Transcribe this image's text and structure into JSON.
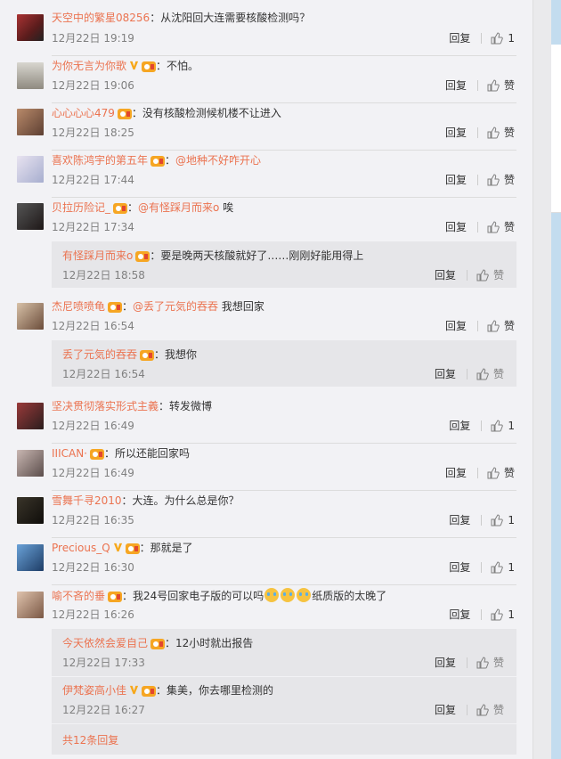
{
  "comments": [
    {
      "user": "天空中的繁星08256",
      "text": "：从沈阳回大连需要核酸检测吗？",
      "time": "12月22日 19:19",
      "reply": "回复",
      "likes": "1",
      "avatar_color": "#7a2b2b"
    },
    {
      "user": "为你无言为你歌",
      "vip": true,
      "medal": true,
      "text": "：不怕。",
      "time": "12月22日 19:06",
      "reply": "回复",
      "likes": "赞",
      "avatar_color": "#b9b6ae"
    },
    {
      "user": "心心心心479",
      "medal": true,
      "text": "：没有核酸检测候机楼不让进入",
      "time": "12月22日 18:25",
      "reply": "回复",
      "likes": "赞",
      "avatar_color": "#8a6a55"
    },
    {
      "user": "喜欢陈鸿宇的第五年",
      "medal": true,
      "at": "@地种不好咋开心",
      "text": "",
      "time": "12月22日 17:44",
      "reply": "回复",
      "likes": "赞",
      "avatar_color": "#c9cbe0"
    },
    {
      "user": "贝拉历险记_",
      "medal": true,
      "at": "@有怪踩月而来o",
      "text": " 唉",
      "time": "12月22日 17:34",
      "reply": "回复",
      "likes": "赞",
      "avatar_color": "#3a2f2f"
    },
    {
      "user": "杰尼喷喷龟",
      "medal": true,
      "at": "@丢了元気的吞吞",
      "text": " 我想回家",
      "time": "12月22日 16:54",
      "reply": "回复",
      "likes": "赞",
      "avatar_color": "#a28870"
    },
    {
      "user": "坚决贯彻落实形式主義",
      "text": "：转发微博",
      "time": "12月22日 16:49",
      "reply": "回复",
      "likes": "1",
      "avatar_color": "#6a2a2a"
    },
    {
      "user": "IIICAN·",
      "medal": true,
      "text": "：所以还能回家吗",
      "time": "12月22日 16:49",
      "reply": "回复",
      "likes": "赞",
      "avatar_color": "#9a8e88"
    },
    {
      "user": "雪舞千寻2010",
      "text": "：大连。为什么总是你？",
      "time": "12月22日 16:35",
      "reply": "回复",
      "likes": "1",
      "avatar_color": "#222018"
    },
    {
      "user": "Precious_Q",
      "vip": true,
      "medal": true,
      "text": "：那就是了",
      "time": "12月22日 16:30",
      "reply": "回复",
      "likes": "1",
      "avatar_color": "#3f6fa6"
    },
    {
      "user": "喻不吝的垂",
      "medal": true,
      "text": "：我24号回家电子版的可以吗",
      "emojis": 3,
      "text2": "纸质版的太晚了",
      "time": "12月22日 16:26",
      "reply": "回复",
      "likes": "1",
      "avatar_color": "#b48c73"
    }
  ],
  "sub_replies": [
    {
      "user": "有怪踩月而来o",
      "medal": true,
      "text": "：要是晚两天核酸就好了……刚刚好能用得上",
      "time": "12月22日 18:58",
      "reply": "回复",
      "likes": "赞"
    },
    {
      "user": "丢了元気的吞吞",
      "medal": true,
      "text": "：我想你",
      "time": "12月22日 16:54",
      "reply": "回复",
      "likes": "赞"
    },
    {
      "user": "今天依然会爱自己",
      "medal": true,
      "text": "：12小时就出报告",
      "time": "12月22日 17:33",
      "reply": "回复",
      "likes": "赞"
    },
    {
      "user": "伊梵姿高小佳",
      "vip": true,
      "medal": true,
      "text": "：集美，你去哪里检测的",
      "time": "12月22日 16:27",
      "reply": "回复",
      "likes": "赞"
    }
  ],
  "more_replies": "共12条回复",
  "colors": {
    "username": "#eb7350",
    "time": "#808080",
    "background": "#f2f2f5",
    "sub_background": "#e6e6e9"
  }
}
